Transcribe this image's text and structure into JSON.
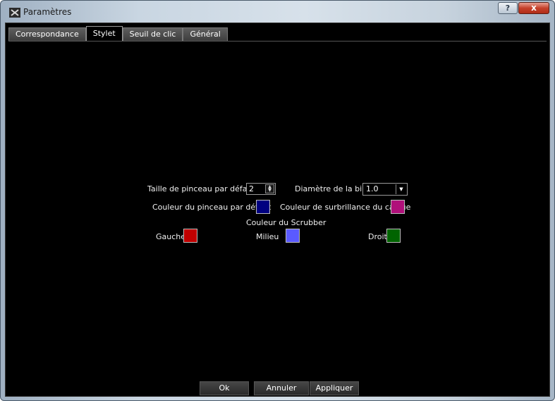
{
  "window": {
    "title": "Paramètres",
    "help": "?",
    "close": "x"
  },
  "tabs": [
    {
      "label": "Correspondance",
      "active": false
    },
    {
      "label": "Stylet",
      "active": true
    },
    {
      "label": "Seuil de clic",
      "active": false
    },
    {
      "label": "Général",
      "active": false
    }
  ],
  "stylet": {
    "brush_size_label": "Taille de pinceau par défaut",
    "brush_size_value": "2",
    "ball_diameter_label": "Diamètre de la bille",
    "ball_diameter_value": "1.0",
    "brush_color_label": "Couleur du pinceau par défaut",
    "brush_color": "#000080",
    "highlight_color_label": "Couleur de surbrillance du calque",
    "highlight_color": "#b0107a",
    "scrubber_title": "Couleur du Scrubber",
    "left_label": "Gauche",
    "left_color": "#c00000",
    "middle_label": "Milieu",
    "middle_color": "#5a5aff",
    "right_label": "Droit",
    "right_color": "#006400"
  },
  "buttons": {
    "ok": "Ok",
    "cancel": "Annuler",
    "apply": "Appliquer"
  },
  "colors": {
    "background": "#000000",
    "text": "#f0f0f0"
  }
}
